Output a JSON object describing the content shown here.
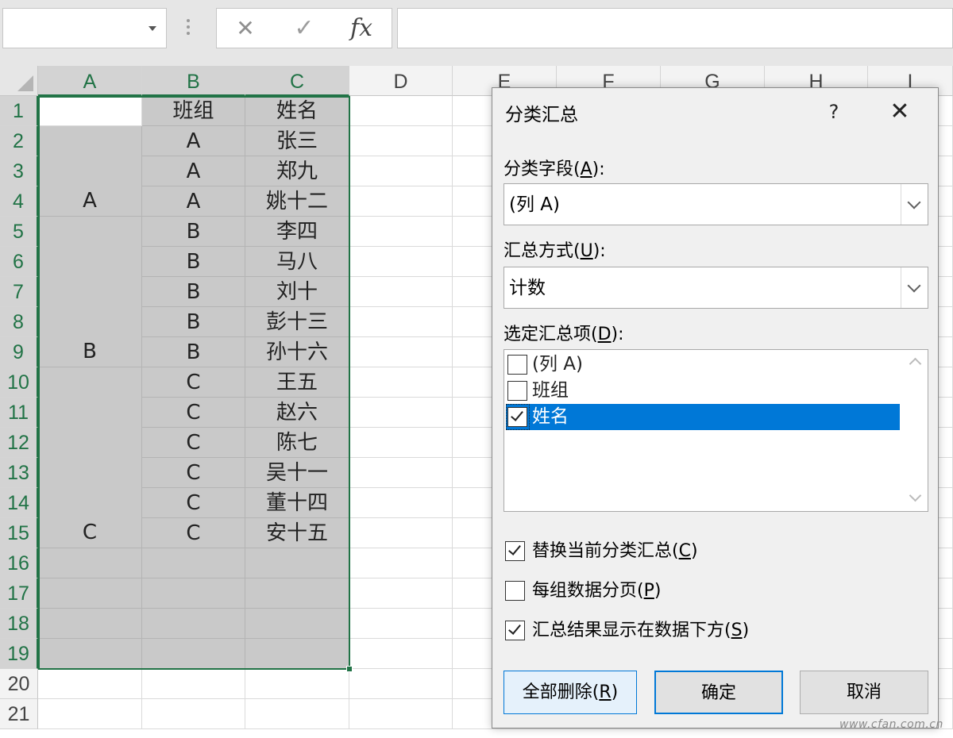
{
  "toolbar": {
    "name_box_value": "",
    "cancel_icon": "✕",
    "enter_icon": "✓",
    "fx_label": "fx",
    "formula_value": ""
  },
  "columns": [
    "A",
    "B",
    "C",
    "D",
    "E",
    "F",
    "G",
    "H",
    "I"
  ],
  "rows": [
    "1",
    "2",
    "3",
    "4",
    "5",
    "6",
    "7",
    "8",
    "9",
    "10",
    "11",
    "12",
    "13",
    "14",
    "15",
    "16",
    "17",
    "18",
    "19",
    "20",
    "21"
  ],
  "sheet": {
    "header_b": "班组",
    "header_c": "姓名",
    "group_a": "A",
    "group_b": "B",
    "group_c": "C",
    "col_b": [
      "A",
      "A",
      "A",
      "B",
      "B",
      "B",
      "B",
      "B",
      "C",
      "C",
      "C",
      "C",
      "C",
      "C"
    ],
    "col_c": [
      "张三",
      "郑九",
      "姚十二",
      "李四",
      "马八",
      "刘十",
      "彭十三",
      "孙十六",
      "王五",
      "赵六",
      "陈七",
      "吴十一",
      "董十四",
      "安十五"
    ]
  },
  "dialog": {
    "title": "分类汇总",
    "help": "?",
    "close": "✕",
    "field_label_pre": "分类字段(",
    "field_label_key": "A",
    "field_label_post": "):",
    "field_value": "(列 A)",
    "func_label_pre": "汇总方式(",
    "func_label_key": "U",
    "func_label_post": "):",
    "func_value": "计数",
    "items_label_pre": "选定汇总项(",
    "items_label_key": "D",
    "items_label_post": "):",
    "items": [
      {
        "label": "(列 A)",
        "checked": false,
        "selected": false
      },
      {
        "label": "班组",
        "checked": false,
        "selected": false
      },
      {
        "label": "姓名",
        "checked": true,
        "selected": true
      }
    ],
    "opt_replace_pre": "替换当前分类汇总(",
    "opt_replace_key": "C",
    "opt_replace_post": ")",
    "opt_replace_checked": true,
    "opt_pagebreak_pre": "每组数据分页(",
    "opt_pagebreak_key": "P",
    "opt_pagebreak_post": ")",
    "opt_pagebreak_checked": false,
    "opt_below_pre": "汇总结果显示在数据下方(",
    "opt_below_key": "S",
    "opt_below_post": ")",
    "opt_below_checked": true,
    "btn_remove_pre": "全部删除(",
    "btn_remove_key": "R",
    "btn_remove_post": ")",
    "btn_ok": "确定",
    "btn_cancel": "取消"
  },
  "watermark": "www.cfan.com.cn",
  "colors": {
    "selection_accent": "#217346",
    "list_selection": "#0078d7",
    "shaded_cell": "#c9c9c9"
  }
}
